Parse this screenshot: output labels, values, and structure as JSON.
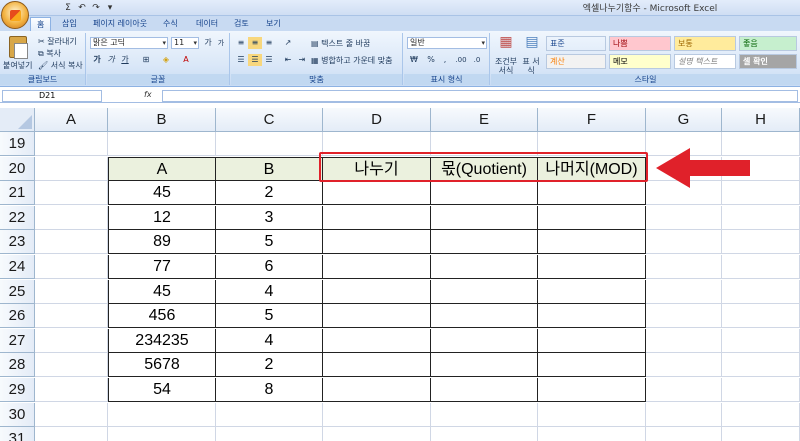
{
  "window": {
    "title": "엑셀나누기함수 - Microsoft Excel"
  },
  "qat": {
    "sum": "Σ",
    "undo": "↶",
    "redo": "↷",
    "more": "▾"
  },
  "tabs": [
    "홈",
    "삽입",
    "페이지 레이아웃",
    "수식",
    "데이터",
    "검토",
    "보기"
  ],
  "ribbon": {
    "clipboard": {
      "label": "클립보드",
      "paste": "붙여넣기",
      "cut": "잘라내기",
      "copy": "복사",
      "format_painter": "서식 복사"
    },
    "font": {
      "label": "글꼴",
      "name": "맑은 고딕",
      "size": "11",
      "bold": "가",
      "italic": "가",
      "underline": "가",
      "grow": "가",
      "shrink": "가"
    },
    "alignment": {
      "label": "맞춤",
      "wrap": "텍스트 줄 바꿈",
      "merge": "병합하고 가운데 맞춤"
    },
    "number": {
      "label": "표시 형식",
      "format": "일반",
      "percent": "%",
      "comma": ",",
      "currency": "₩"
    },
    "styles": {
      "label": "스타일",
      "conditional": "조건부 서식",
      "table": "표 서식",
      "cells": [
        {
          "text": "표준",
          "bg": "#ffffff",
          "fg": "#000000"
        },
        {
          "text": "나쁨",
          "bg": "#ffc7ce",
          "fg": "#9c0006"
        },
        {
          "text": "보통",
          "bg": "#ffeb9c",
          "fg": "#9c6500"
        },
        {
          "text": "좋음",
          "bg": "#c6efce",
          "fg": "#006100"
        },
        {
          "text": "계산",
          "bg": "#f2f2f2",
          "fg": "#fa7d00"
        },
        {
          "text": "메모",
          "bg": "#ffffcc",
          "fg": "#000000"
        },
        {
          "text": "설명 텍스트",
          "bg": "#ffffff",
          "fg": "#7f7f7f"
        },
        {
          "text": "셀 확인",
          "bg": "#a5a5a5",
          "fg": "#ffffff"
        }
      ]
    }
  },
  "formula_bar": {
    "name_box": "D21",
    "fx": "fx"
  },
  "grid": {
    "columns": [
      "A",
      "B",
      "C",
      "D",
      "E",
      "F",
      "G",
      "H"
    ],
    "rows": [
      "19",
      "20",
      "21",
      "22",
      "23",
      "24",
      "25",
      "26",
      "27",
      "28",
      "29",
      "30",
      "31"
    ],
    "table_header": [
      "A",
      "B",
      "나누기",
      "몫(Quotient)",
      "나머지(MOD)"
    ],
    "table_rows": [
      [
        "45",
        "2"
      ],
      [
        "12",
        "3"
      ],
      [
        "89",
        "5"
      ],
      [
        "77",
        "6"
      ],
      [
        "45",
        "4"
      ],
      [
        "456",
        "5"
      ],
      [
        "234235",
        "4"
      ],
      [
        "5678",
        "2"
      ],
      [
        "54",
        "8"
      ]
    ]
  },
  "colors": {
    "highlight": "#e0212a",
    "header_fill": "#ebf1de"
  }
}
